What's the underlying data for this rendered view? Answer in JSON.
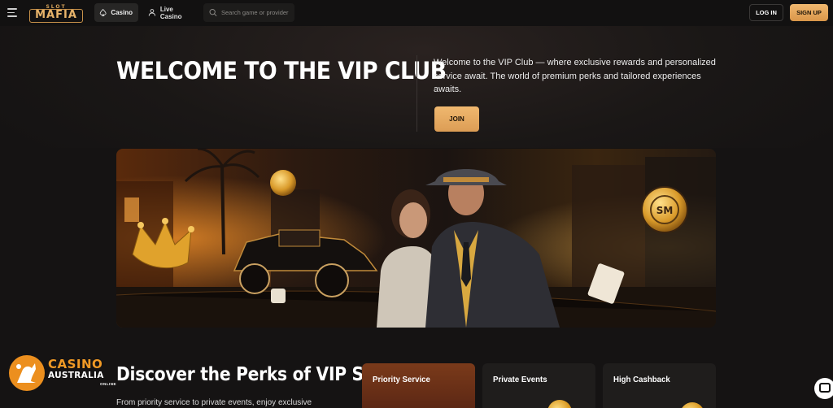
{
  "header": {
    "logo_top": "SLOT",
    "logo_main": "MAFIA",
    "nav": [
      {
        "label": "Casino",
        "icon": "spade-icon",
        "active": true
      },
      {
        "label": "Live Casino",
        "icon": "dealer-icon",
        "active": false
      }
    ],
    "search_placeholder": "Search game or provider",
    "login_label": "LOG IN",
    "signup_label": "SIGN UP"
  },
  "hero": {
    "title": "WELCOME TO THE VIP CLUB",
    "description": "Welcome to the VIP Club — where exclusive rewards and personalized service await. The world of premium perks and tailored experiences awaits.",
    "join_label": "JOIN"
  },
  "badge": {
    "line1": "CASINO",
    "line2": "AUSTRALIA",
    "line3": "ONLINE"
  },
  "perks": {
    "title": "Discover the Perks of VIP Status",
    "subtitle": "From priority service to private events, enjoy exclusive",
    "cards": [
      {
        "label": "Priority Service"
      },
      {
        "label": "Private Events"
      },
      {
        "label": "High Cashback"
      }
    ]
  },
  "colors": {
    "accent": "#e8a85c",
    "background": "#151313",
    "badge_orange": "#ec8f1e"
  }
}
